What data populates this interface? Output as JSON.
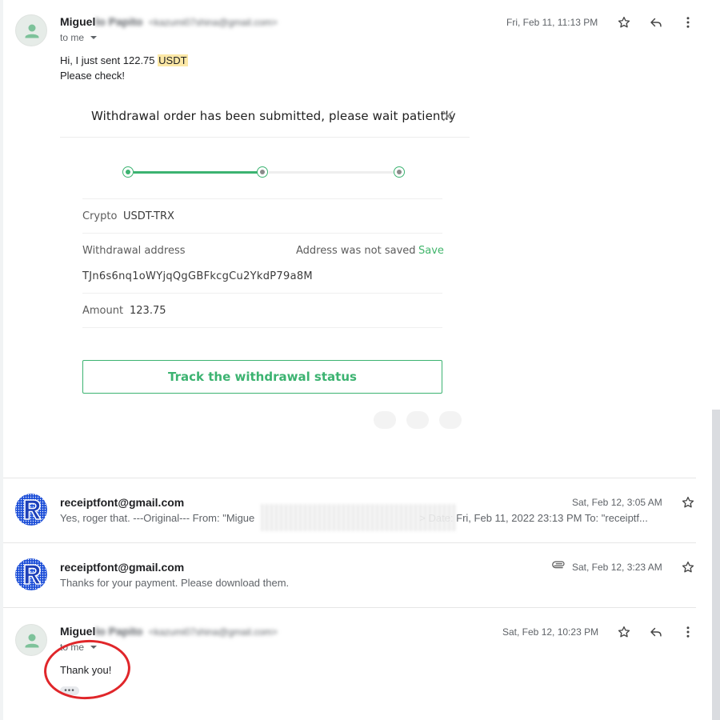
{
  "emails": [
    {
      "sender_name": "Miguel",
      "sender_name_blurred": "lo Papito",
      "sender_email": "<kazumi07shina@gmail.com>",
      "recipient": "to me",
      "date": "Fri, Feb 11, 11:13 PM",
      "body_prefix": "Hi, I just sent 122.75",
      "body_highlight": "USDT",
      "body_line2": "Please check!"
    },
    {
      "sender_name": "receiptfont@gmail.com",
      "date": "Sat, Feb 12, 3:05 AM",
      "snippet_start": "Yes, roger that. ---Original--- From: \"Migue",
      "snippet_end": "> Date: Fri, Feb 11, 2022 23:13 PM To: \"receiptf..."
    },
    {
      "sender_name": "receiptfont@gmail.com",
      "date": "Sat, Feb 12, 3:23 AM",
      "snippet": "Thanks for your payment. Please download them."
    },
    {
      "sender_name": "Miguel",
      "sender_name_blurred": "lo Papito",
      "sender_email": "<kazumi07shina@gmail.com>",
      "recipient": "to me",
      "date": "Sat, Feb 12, 10:23 PM",
      "body": "Thank you!",
      "more_label": "•••"
    }
  ],
  "card": {
    "title": "Withdrawal order has been submitted, please wait patiently",
    "crypto_label": "Crypto",
    "crypto_value": "USDT-TRX",
    "address_label": "Withdrawal address",
    "address_status": "Address was not saved",
    "save_label": "Save",
    "address_value": "TJn6s6nq1oWYjqQgGBFkcgCu2YkdP79a8M",
    "amount_label": "Amount",
    "amount_value": "123.75",
    "track_button": "Track the withdrawal status",
    "progress_steps_completed": 2,
    "progress_steps_total": 3
  },
  "icons": {
    "star": "star-icon",
    "reply": "reply-icon",
    "more": "more-vert-icon",
    "attachment": "paperclip-icon",
    "close": "close-icon",
    "avatar": "person-icon"
  },
  "colors": {
    "accent_green": "#3cb371",
    "highlight": "#fce8a6",
    "annotation_red": "#e0262a"
  }
}
